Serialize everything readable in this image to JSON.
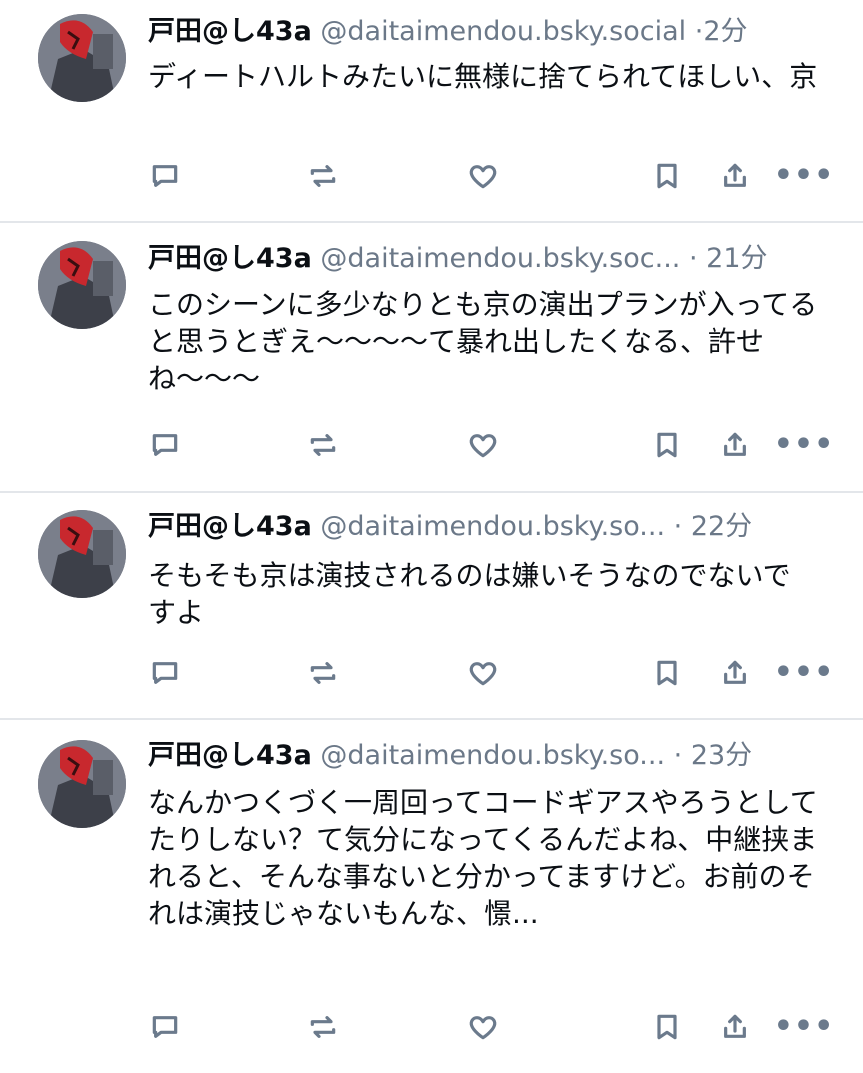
{
  "posts": [
    {
      "author_name": "戸田@し43a",
      "handle": "@daitaimendou.bsky.social",
      "separator": "·",
      "time": "2分",
      "text": "ディートハルトみたいに無様に捨てられてほしい、京",
      "actions": [
        "reply-icon",
        "repost-icon",
        "like-icon",
        "bookmark-icon",
        "share-icon",
        "more-icon"
      ]
    },
    {
      "author_name": "戸田@し43a",
      "handle": "@daitaimendou.bsky.soc...",
      "separator": "·",
      "time": "21分",
      "text": "このシーンに多少なりとも京の演出プランが入ってると思うとぎえ〜〜〜〜て暴れ出したくなる、許せね〜〜〜",
      "actions": [
        "reply-icon",
        "repost-icon",
        "like-icon",
        "bookmark-icon",
        "share-icon",
        "more-icon"
      ]
    },
    {
      "author_name": "戸田@し43a",
      "handle": "@daitaimendou.bsky.so...",
      "separator": "·",
      "time": "22分",
      "text": "そもそも京は演技されるのは嫌いそうなのでないですよ",
      "actions": [
        "reply-icon",
        "repost-icon",
        "like-icon",
        "bookmark-icon",
        "share-icon",
        "more-icon"
      ]
    },
    {
      "author_name": "戸田@し43a",
      "handle": "@daitaimendou.bsky.so...",
      "separator": "·",
      "time": "23分",
      "text": "なんかつくづく一周回ってコードギアスやろうとしてたりしない？て気分になってくるんだよね、中継挟まれると、そんな事ないと分かってますけど。お前のそれは演技じゃないもんな、憬...",
      "actions": [
        "reply-icon",
        "repost-icon",
        "like-icon",
        "bookmark-icon",
        "share-icon",
        "more-icon"
      ]
    }
  ],
  "more_glyph": "•••",
  "colors": {
    "text": "#0b0f14",
    "muted": "#6b7888",
    "icon": "#6b7a8c",
    "divider": "#e3e6ea",
    "background": "#ffffff"
  }
}
